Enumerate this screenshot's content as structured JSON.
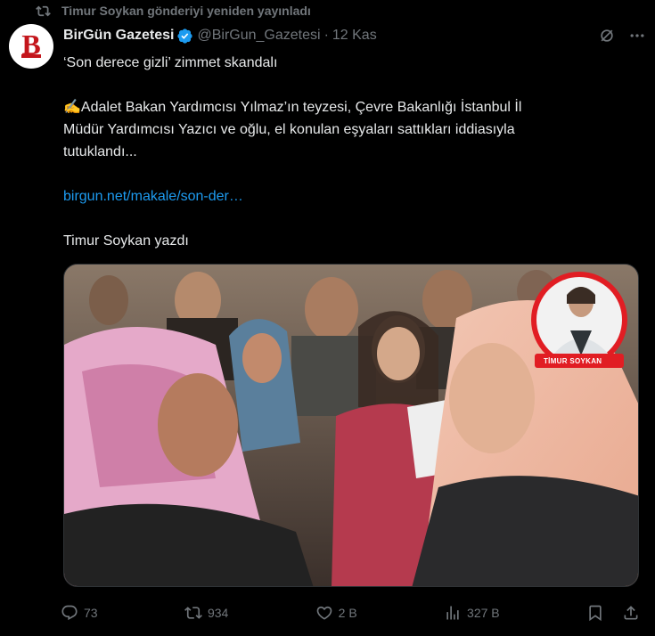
{
  "repost": {
    "icon": "repost-icon",
    "text": "Timur Soykan gönderiyi yeniden yayınladı"
  },
  "author": {
    "name": "BirGün Gazetesi",
    "handle": "@BirGun_Gazetesi",
    "separator": "·",
    "date": "12 Kas",
    "avatar_letter": "B",
    "verified": true,
    "verified_color": "#1d9bf0",
    "avatar_color": "#c4161c"
  },
  "tweet": {
    "line1": "‘Son derece gizli’ zimmet skandalı",
    "line2_emoji": "✍️",
    "line2a": "Adalet Bakan Yardımcısı Yılmaz’ın teyzesi, Çevre Bakanlığı İstanbul İl",
    "line2b": "Müdür Yardımcısı Yazıcı ve oğlu, el konulan eşyaları sattıkları iddiasıyla",
    "line2c": "tutuklandı...",
    "link": "birgun.net/makale/son-der…",
    "byline": "Timur Soykan yazdı",
    "link_color": "#1d9bf0"
  },
  "media": {
    "badge_label": "TİMUR SOYKAN",
    "badge_color": "#e11d23"
  },
  "actions": {
    "replies": "73",
    "reposts": "934",
    "likes": "2 B",
    "views": "327 B",
    "icons": [
      "reply-icon",
      "repost-icon",
      "like-icon",
      "views-icon",
      "bookmark-icon",
      "share-icon"
    ]
  },
  "colors": {
    "background": "#000000",
    "text": "#e7e9ea",
    "muted": "#71767b"
  }
}
